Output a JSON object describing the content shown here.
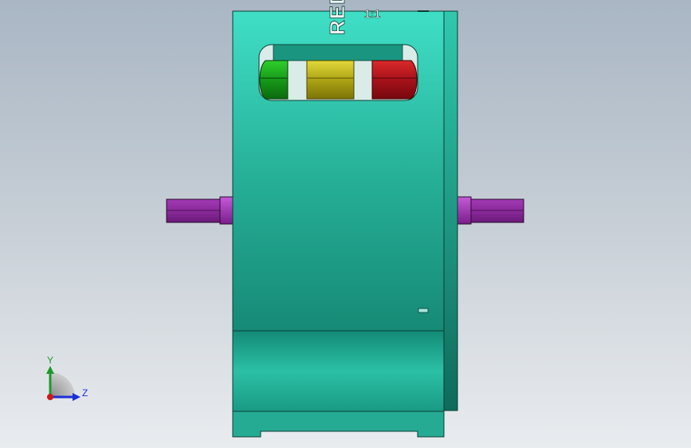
{
  "model": {
    "engraving_main": "RED",
    "engraving_secondary": "1:1"
  },
  "triad": {
    "y_label": "Y",
    "z_label": "Z",
    "y_color": "#1f9a2a",
    "z_color": "#1b2fd6",
    "x_color": "#d01818"
  },
  "colors": {
    "housing": "#27b49a",
    "housing_light": "#3fdac0",
    "housing_dark": "#137a68",
    "shaft": "#8a2a99",
    "gear_green": "#19a21d",
    "gear_yellow": "#b4ab1a",
    "gear_red": "#b4151a"
  }
}
